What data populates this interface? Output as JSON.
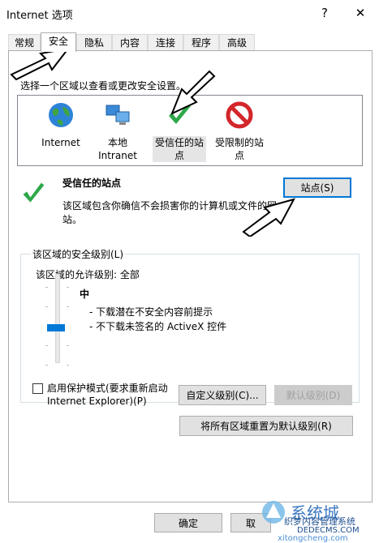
{
  "window": {
    "title": "Internet 选项",
    "help": "?",
    "close": "✕"
  },
  "tabs": [
    "常规",
    "安全",
    "隐私",
    "内容",
    "连接",
    "程序",
    "高级"
  ],
  "instruction": "选择一个区域以查看或更改安全设置。",
  "zones": [
    {
      "line1": "Internet",
      "line2": ""
    },
    {
      "line1": "本地",
      "line2": "Intranet"
    },
    {
      "line1": "受信任的站",
      "line2": "点"
    },
    {
      "line1": "受限制的站",
      "line2": "点"
    }
  ],
  "zone_info": {
    "title": "受信任的站点",
    "desc_line1": "该区域包含你确信不会损害你的计算机或文件的网",
    "desc_line2": "站。",
    "sites_button": "站点(S)"
  },
  "security_level": {
    "group_title": "该区域的安全级别(L)",
    "allowed": "该区域的允许级别: 全部",
    "level": "中",
    "bullet1": "- 下载潜在不安全内容前提示",
    "bullet2": "- 不下载未签名的 ActiveX 控件",
    "protected_mode_line1": "启用保护模式(要求重新启动",
    "protected_mode_line2": "Internet Explorer)(P)",
    "custom_button": "自定义级别(C)...",
    "default_button": "默认级别(D)",
    "reset_all_button": "将所有区域重置为默认级别(R)"
  },
  "footer": {
    "ok": "确定",
    "cancel": "取"
  },
  "watermark": {
    "brand": "系统城",
    "text1": "织梦内容管理系统",
    "text2": "DEDECMS.COM",
    "text3": "xitongcheng.com"
  }
}
